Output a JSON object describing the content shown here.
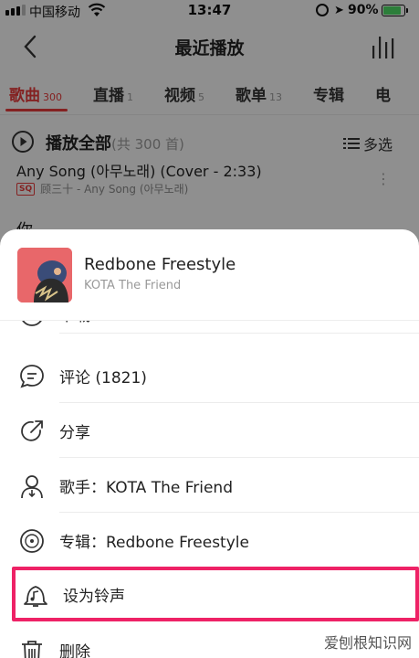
{
  "status_bar": {
    "carrier": "中国移动",
    "time": "13:47",
    "battery_percent": "90%",
    "battery_level": 0.9
  },
  "nav": {
    "title": "最近播放"
  },
  "tabs": [
    {
      "label": "歌曲",
      "count": "300",
      "active": true
    },
    {
      "label": "直播",
      "count": "1",
      "active": false
    },
    {
      "label": "视频",
      "count": "5",
      "active": false
    },
    {
      "label": "歌单",
      "count": "13",
      "active": false
    },
    {
      "label": "专辑",
      "count": "",
      "active": false
    },
    {
      "label": "电",
      "count": "",
      "active": false
    }
  ],
  "list_header": {
    "play_all": "播放全部",
    "count": "(共 300 首)",
    "multi_select": "多选"
  },
  "background_song": {
    "title": "Any Song (아무노래) (Cover - 2:33)",
    "quality_badge": "SQ",
    "subtitle": "顾三十 - Any Song (아무노래)",
    "next_title": "你"
  },
  "sheet": {
    "song_name": "Redbone Freestyle",
    "artist": "KOTA The Friend",
    "menu": [
      {
        "icon": "download-icon",
        "label": "下载"
      },
      {
        "icon": "comment-icon",
        "label": "评论 (1821)"
      },
      {
        "icon": "share-icon",
        "label": "分享"
      },
      {
        "icon": "artist-icon",
        "label": "歌手：KOTA The Friend"
      },
      {
        "icon": "album-icon",
        "label": "专辑：Redbone Freestyle"
      },
      {
        "icon": "ringtone-icon",
        "label": "设为铃声"
      },
      {
        "icon": "trash-icon",
        "label": "删除"
      }
    ]
  },
  "watermark": "爱刨根知识网",
  "colors": {
    "accent": "#e33a3a",
    "highlight": "#ee2266"
  }
}
